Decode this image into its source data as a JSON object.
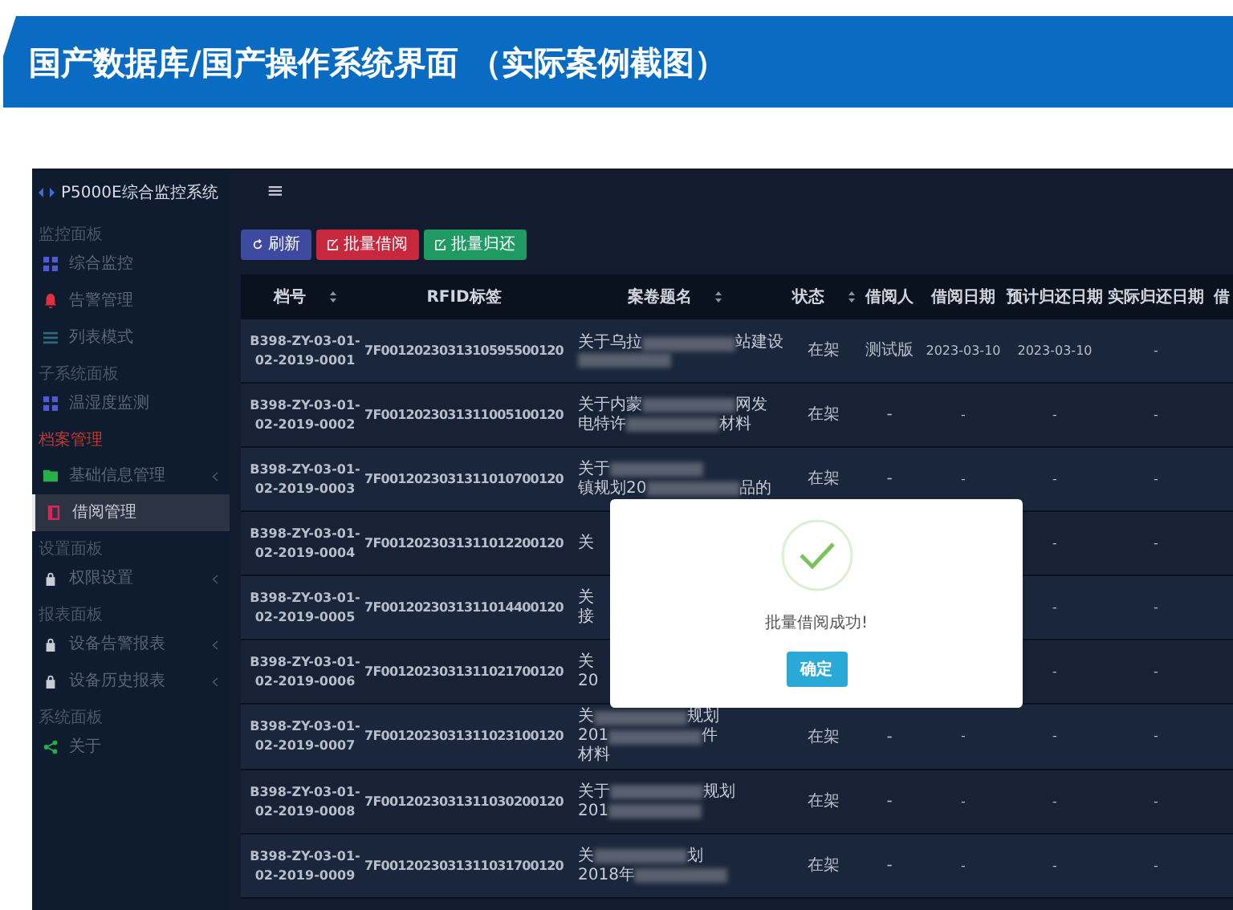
{
  "banner": {
    "title": "国产数据库/国产操作系统界面 （实际案例截图）"
  },
  "sidebar": {
    "app_title": "P5000E综合监控系统",
    "items": [
      {
        "kind": "section",
        "label": "监控面板"
      },
      {
        "kind": "grid",
        "label": "综合监控",
        "color": "#4f5bd5",
        "chevron": false,
        "selected": false
      },
      {
        "kind": "bell",
        "label": "告警管理",
        "color": "#e0303f",
        "chevron": false,
        "selected": false
      },
      {
        "kind": "list",
        "label": "列表模式",
        "color": "#2b6b7a",
        "chevron": false,
        "selected": false
      },
      {
        "kind": "section",
        "label": "子系统面板"
      },
      {
        "kind": "grid",
        "label": "温湿度监测",
        "color": "#4f5bd5",
        "chevron": false,
        "selected": false
      },
      {
        "kind": "category",
        "label": "档案管理"
      },
      {
        "kind": "folder",
        "label": "基础信息管理",
        "color": "#25b04a",
        "chevron": true,
        "selected": false
      },
      {
        "kind": "book",
        "label": "借阅管理",
        "color": "#d02a5a",
        "chevron": false,
        "selected": true
      },
      {
        "kind": "section",
        "label": "设置面板"
      },
      {
        "kind": "lock",
        "label": "权限设置",
        "color": "#c8ccd4",
        "chevron": true,
        "selected": false
      },
      {
        "kind": "section",
        "label": "报表面板"
      },
      {
        "kind": "lock",
        "label": "设备告警报表",
        "color": "#c8ccd4",
        "chevron": true,
        "selected": false
      },
      {
        "kind": "lock",
        "label": "设备历史报表",
        "color": "#c8ccd4",
        "chevron": true,
        "selected": false
      },
      {
        "kind": "section",
        "label": "系统面板"
      },
      {
        "kind": "share",
        "label": "关于",
        "color": "#25b04a",
        "chevron": false,
        "selected": false
      }
    ]
  },
  "toolbar": {
    "menu_glyph": "≡",
    "buttons": [
      {
        "label": "刷新",
        "kind": "refresh"
      },
      {
        "label": "批量借阅",
        "kind": "borrow"
      },
      {
        "label": "批量归还",
        "kind": "return"
      }
    ]
  },
  "table": {
    "columns": [
      {
        "label": "档号",
        "sortable": true
      },
      {
        "label": "RFID标签",
        "sortable": false
      },
      {
        "label": "案卷题名",
        "sortable": true
      },
      {
        "label": "状态",
        "sortable": true
      },
      {
        "label": "借阅人",
        "sortable": false
      },
      {
        "label": "借阅日期",
        "sortable": false
      },
      {
        "label": "预计归还日期",
        "sortable": false
      },
      {
        "label": "实际归还日期",
        "sortable": false
      },
      {
        "label": "借",
        "sortable": false
      }
    ],
    "rows": [
      {
        "id": "B398-ZY-03-01-02-2019-0001",
        "rfid": "7F0012023031310595500120",
        "title": [
          [
            {
              "kind": "text",
              "text": "关于乌拉"
            },
            {
              "kind": "redacted"
            },
            {
              "kind": "text",
              "text": "站建设"
            }
          ],
          [
            {
              "kind": "redacted"
            }
          ]
        ],
        "status": "在架",
        "borrower": "测试版",
        "borrow_date": "2023-03-10",
        "due_date": "2023-03-10",
        "return_date": "-"
      },
      {
        "id": "B398-ZY-03-01-02-2019-0002",
        "rfid": "7F0012023031311005100120",
        "title": [
          [
            {
              "kind": "text",
              "text": "关于内蒙"
            },
            {
              "kind": "redacted"
            },
            {
              "kind": "text",
              "text": "网发"
            }
          ],
          [
            {
              "kind": "text",
              "text": "电特许"
            },
            {
              "kind": "redacted"
            },
            {
              "kind": "text",
              "text": "材料"
            }
          ]
        ],
        "status": "在架",
        "borrower": "-",
        "borrow_date": "-",
        "due_date": "-",
        "return_date": "-"
      },
      {
        "id": "B398-ZY-03-01-02-2019-0003",
        "rfid": "7F0012023031311010700120",
        "title": [
          [
            {
              "kind": "text",
              "text": "关于"
            },
            {
              "kind": "redacted"
            }
          ],
          [
            {
              "kind": "text",
              "text": "镇规划20"
            },
            {
              "kind": "redacted"
            },
            {
              "kind": "text",
              "text": "品的"
            }
          ]
        ],
        "status": "在架",
        "borrower": "-",
        "borrow_date": "-",
        "due_date": "-",
        "return_date": "-"
      },
      {
        "id": "B398-ZY-03-01-02-2019-0004",
        "rfid": "7F0012023031311012200120",
        "title": [
          [
            {
              "kind": "text",
              "text": "关"
            }
          ]
        ],
        "due_date": "-",
        "return_date": "-"
      },
      {
        "id": "B398-ZY-03-01-02-2019-0005",
        "rfid": "7F0012023031311014400120",
        "title": [
          [
            {
              "kind": "text",
              "text": "关"
            }
          ],
          [
            {
              "kind": "text",
              "text": "接"
            }
          ]
        ],
        "due_date": "-",
        "return_date": "-"
      },
      {
        "id": "B398-ZY-03-01-02-2019-0006",
        "rfid": "7F0012023031311021700120",
        "title": [
          [
            {
              "kind": "text",
              "text": "关"
            }
          ],
          [
            {
              "kind": "text",
              "text": "20"
            }
          ]
        ],
        "due_date": "-",
        "return_date": "-"
      },
      {
        "id": "B398-ZY-03-01-02-2019-0007",
        "rfid": "7F0012023031311023100120",
        "title": [
          [
            {
              "kind": "text",
              "text": "关"
            },
            {
              "kind": "redacted"
            },
            {
              "kind": "text",
              "text": "规划"
            }
          ],
          [
            {
              "kind": "text",
              "text": "201"
            },
            {
              "kind": "redacted"
            },
            {
              "kind": "text",
              "text": "件"
            }
          ],
          [
            {
              "kind": "text",
              "text": "材料"
            }
          ]
        ],
        "status": "在架",
        "borrower": "-",
        "borrow_date": "-",
        "due_date": "-",
        "return_date": "-"
      },
      {
        "id": "B398-ZY-03-01-02-2019-0008",
        "rfid": "7F0012023031311030200120",
        "title": [
          [
            {
              "kind": "text",
              "text": "关于"
            },
            {
              "kind": "redacted"
            },
            {
              "kind": "text",
              "text": "规划"
            }
          ],
          [
            {
              "kind": "text",
              "text": "201"
            },
            {
              "kind": "redacted"
            }
          ]
        ],
        "status": "在架",
        "borrower": "-",
        "borrow_date": "-",
        "due_date": "-",
        "return_date": "-"
      },
      {
        "id": "B398-ZY-03-01-02-2019-0009",
        "rfid": "7F0012023031311031700120",
        "title": [
          [
            {
              "kind": "text",
              "text": "关"
            },
            {
              "kind": "redacted"
            },
            {
              "kind": "text",
              "text": "划"
            }
          ],
          [
            {
              "kind": "text",
              "text": "2018年"
            },
            {
              "kind": "redacted"
            }
          ]
        ],
        "status": "在架",
        "borrower": "-",
        "borrow_date": "-",
        "due_date": "-",
        "return_date": "-"
      }
    ]
  },
  "dialog": {
    "message": "批量借阅成功!",
    "button": "确定"
  }
}
